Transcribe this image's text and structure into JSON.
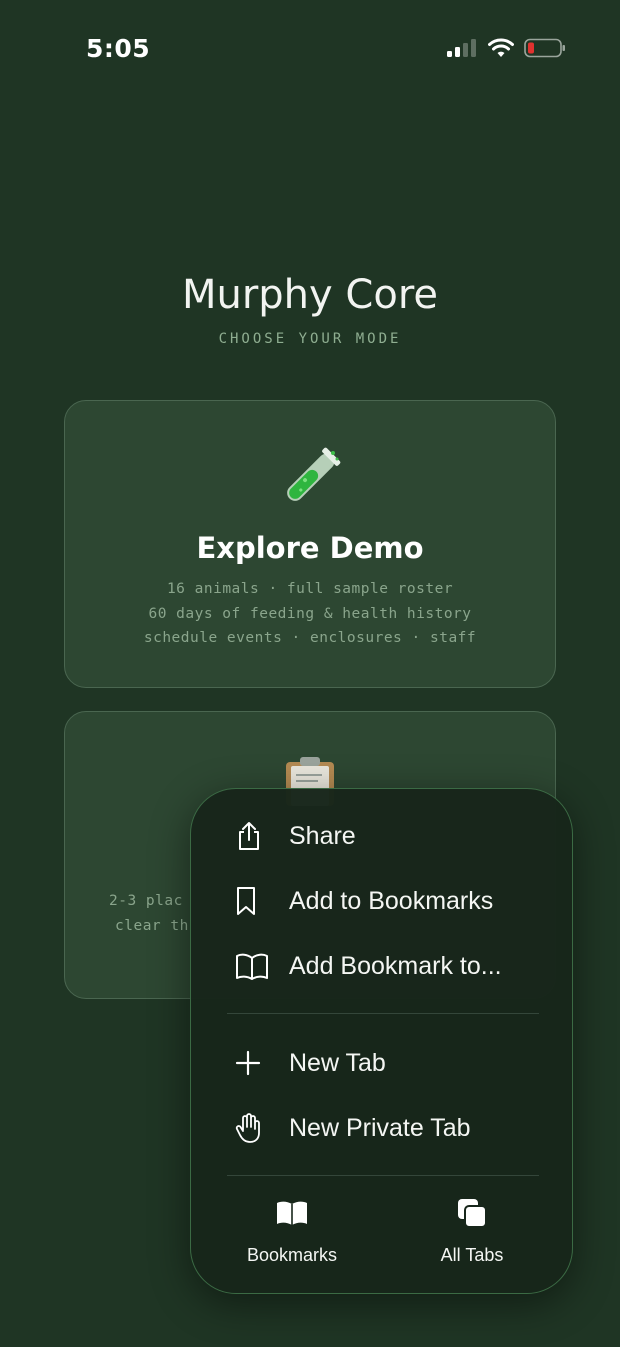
{
  "status": {
    "time": "5:05"
  },
  "header": {
    "title": "Murphy Core",
    "subtitle": "CHOOSE YOUR MODE"
  },
  "cards": {
    "demo": {
      "icon": "🧪",
      "title": "Explore Demo",
      "lines": [
        "16 animals · full sample roster",
        "60 days of feeding & health history",
        "schedule events · enclosures · staff"
      ]
    },
    "fresh": {
      "icon": "📋",
      "lines_visible": [
        "2-3 plac",
        "clear th"
      ]
    }
  },
  "menu": {
    "items": [
      {
        "icon": "share-icon",
        "label": "Share"
      },
      {
        "icon": "bookmark-icon",
        "label": "Add to Bookmarks"
      },
      {
        "icon": "book-icon",
        "label": "Add Bookmark to..."
      },
      {
        "icon": "plus-icon",
        "label": "New Tab"
      },
      {
        "icon": "hand-icon",
        "label": "New Private Tab"
      }
    ],
    "bottom": {
      "bookmarks_label": "Bookmarks",
      "all_tabs_label": "All Tabs"
    }
  },
  "colors": {
    "background": "#1f3524",
    "card": "#2d4732",
    "menu": "#17261b",
    "muted_text": "#8aa58c",
    "battery_low": "#e0322f"
  }
}
